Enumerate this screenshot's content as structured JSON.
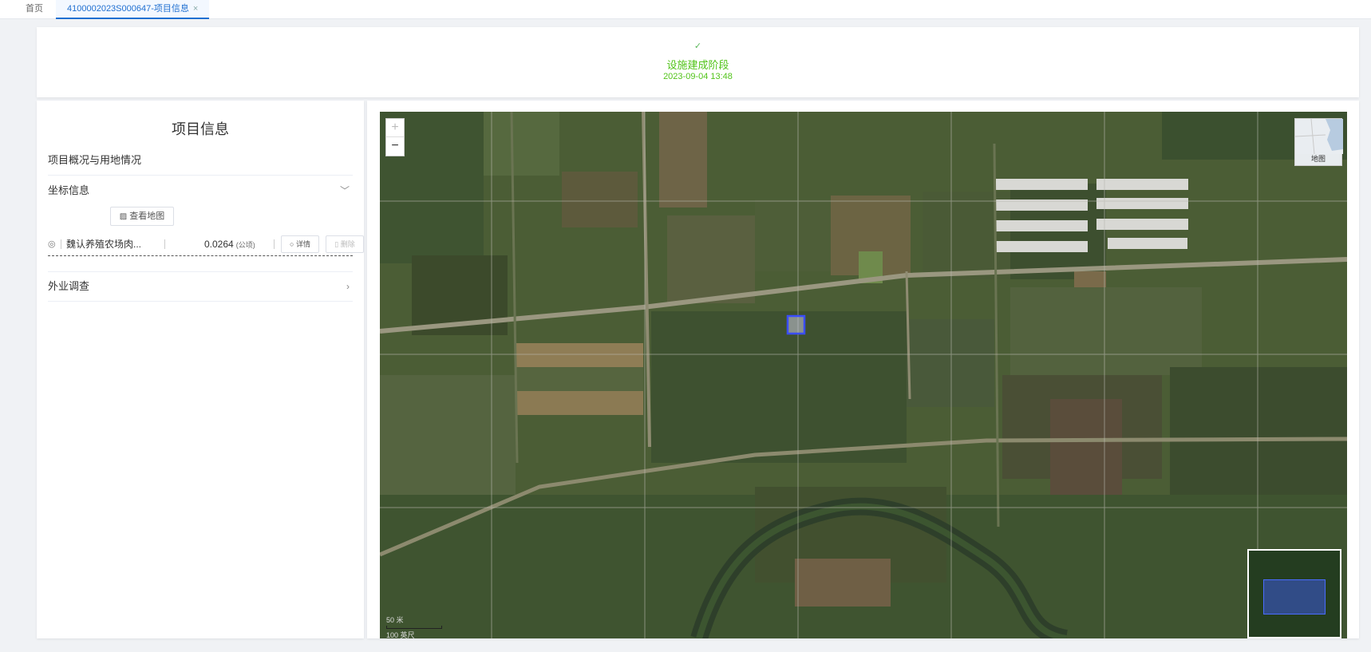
{
  "tabs": [
    {
      "label": "首页"
    },
    {
      "label": "4100002023S000647-项目信息",
      "close": "×"
    }
  ],
  "status": {
    "icon": "check-icon",
    "title": "设施建成阶段",
    "time": "2023-09-04 13:48",
    "color": "#52c41a"
  },
  "left_panel": {
    "title": "项目信息",
    "overview_label": "项目概况与用地情况",
    "coords_label": "坐标信息",
    "view_map_label": "查看地图",
    "coord_item": {
      "name": "魏认养殖农场肉...",
      "area": "0.0264",
      "unit": "(公顷)",
      "detail_label": "详情",
      "delete_label": "删除"
    },
    "survey_label": "外业调查"
  },
  "map": {
    "zoom_in": "+",
    "zoom_out": "−",
    "layer_switch_label": "地图",
    "scale_top": "50 米",
    "scale_bottom": "100 英尺"
  }
}
